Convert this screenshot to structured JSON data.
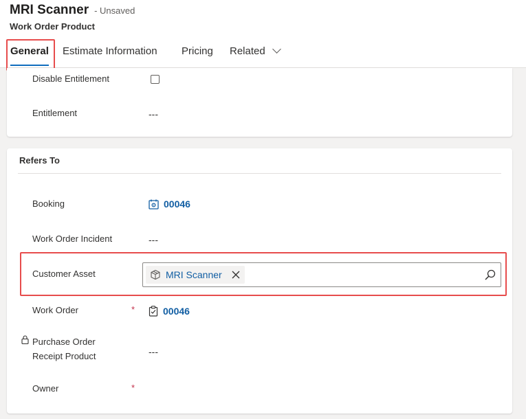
{
  "header": {
    "title": "MRI Scanner",
    "status": "- Unsaved",
    "entity": "Work Order Product"
  },
  "tabs": [
    {
      "label": "General",
      "active": true
    },
    {
      "label": "Estimate Information",
      "active": false
    },
    {
      "label": "Pricing",
      "active": false
    },
    {
      "label": "Related",
      "active": false
    }
  ],
  "section1": {
    "fields": {
      "disable_entitlement": {
        "label": "Disable Entitlement",
        "checked": false
      },
      "entitlement": {
        "label": "Entitlement",
        "value": "---"
      }
    }
  },
  "section2": {
    "title": "Refers To",
    "fields": {
      "booking": {
        "label": "Booking",
        "value": "00046"
      },
      "work_order_incident": {
        "label": "Work Order Incident",
        "value": "---"
      },
      "customer_asset": {
        "label": "Customer Asset",
        "value": "MRI Scanner"
      },
      "work_order": {
        "label": "Work Order",
        "required": "*",
        "value": "00046"
      },
      "purchase_order_receipt_product": {
        "label_line1": "Purchase Order",
        "label_line2": "Receipt Product",
        "value": "---"
      },
      "owner": {
        "label": "Owner",
        "required": "*",
        "value": ""
      }
    }
  },
  "icons": {
    "booking": "calendar-gear-icon",
    "customer_asset": "box-icon",
    "work_order": "clipboard-icon",
    "remove": "close-icon",
    "search": "search-icon",
    "lock": "lock-icon",
    "related": "chevron-down-icon"
  },
  "colors": {
    "accent": "#0f6cbd",
    "link": "#115ea3",
    "required": "#c4314b",
    "highlight": "#e74c4c"
  }
}
